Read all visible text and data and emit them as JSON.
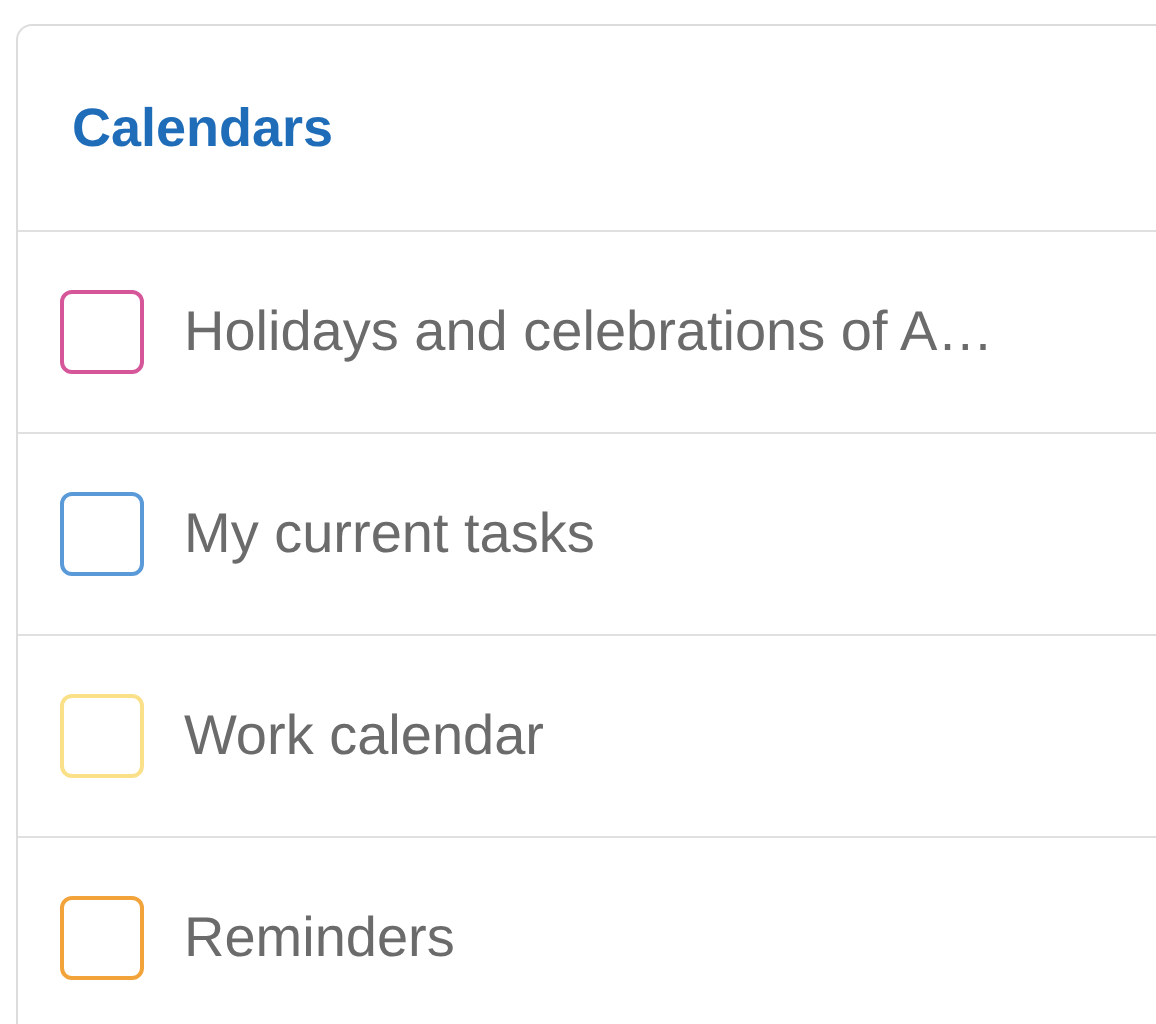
{
  "panel": {
    "title": "Calendars"
  },
  "calendars": [
    {
      "label": "Holidays and celebrations of A…",
      "checked": false,
      "color": "#d6569a"
    },
    {
      "label": "My current tasks",
      "checked": false,
      "color": "#5a9ad8"
    },
    {
      "label": "Work calendar",
      "checked": false,
      "color": "#fbe08a"
    },
    {
      "label": "Reminders",
      "checked": false,
      "color": "#f2a43a"
    }
  ]
}
